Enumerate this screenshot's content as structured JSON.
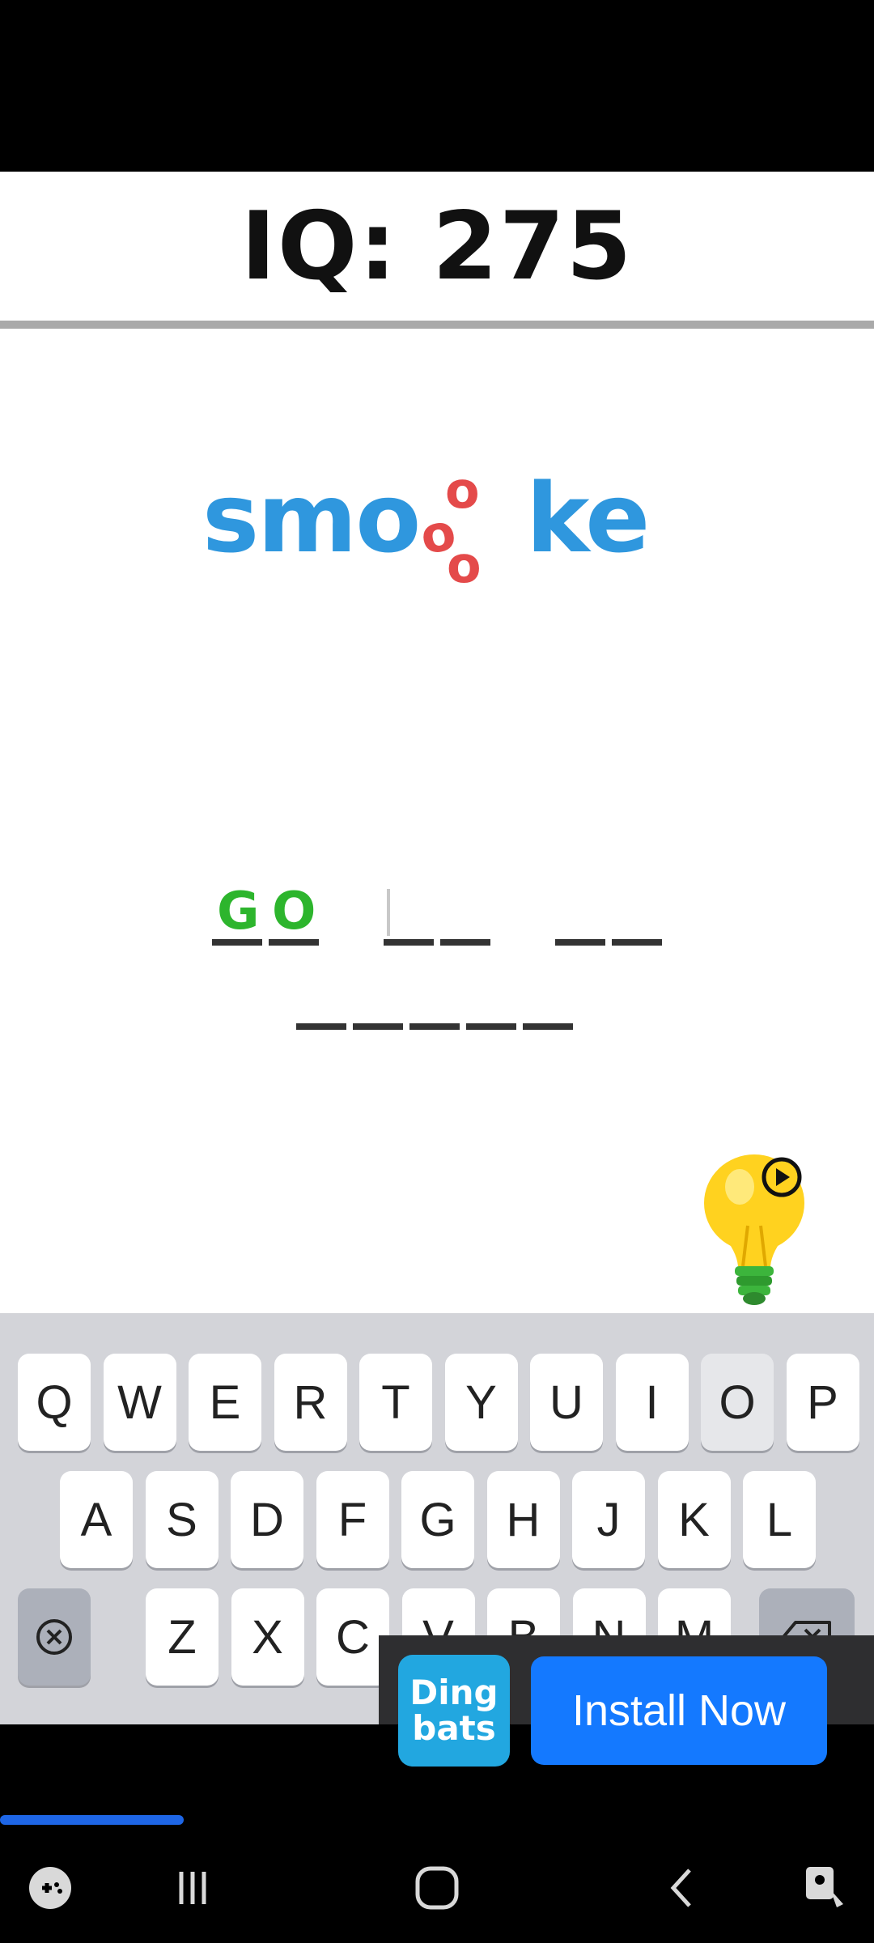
{
  "header": {
    "iq_text": "IQ: 275"
  },
  "puzzle": {
    "word_left": "smo",
    "word_right": "ke",
    "inserted_letters": [
      "o",
      "o",
      "o"
    ]
  },
  "answer": {
    "revealed": [
      "G",
      "O"
    ],
    "slots_per_word": [
      2,
      2,
      2,
      5
    ],
    "filled_count": 2
  },
  "keyboard": {
    "row1": [
      "Q",
      "W",
      "E",
      "R",
      "T",
      "Y",
      "U",
      "I",
      "O",
      "P"
    ],
    "row2": [
      "A",
      "S",
      "D",
      "F",
      "G",
      "H",
      "J",
      "K",
      "L"
    ],
    "row3": [
      "Z",
      "X",
      "C",
      "V",
      "B",
      "N",
      "M"
    ],
    "pressed_key": "O"
  },
  "ad": {
    "app_name_line1": "Ding",
    "app_name_line2": "bats",
    "button_label": "Install Now"
  },
  "progress": {
    "fraction": 0.21
  },
  "colors": {
    "puzzle_blue": "#2f97de",
    "puzzle_red": "#e44a4a",
    "answer_green": "#2db52d",
    "install_blue": "#1479ff",
    "progress_blue": "#1e66e6"
  },
  "icons": {
    "hint": "lightbulb-play-icon",
    "clear": "circle-x-icon",
    "backspace": "backspace-icon",
    "nav": [
      "gamepad-icon",
      "recent-apps-icon",
      "home-icon",
      "back-icon",
      "screenshot-icon"
    ]
  }
}
